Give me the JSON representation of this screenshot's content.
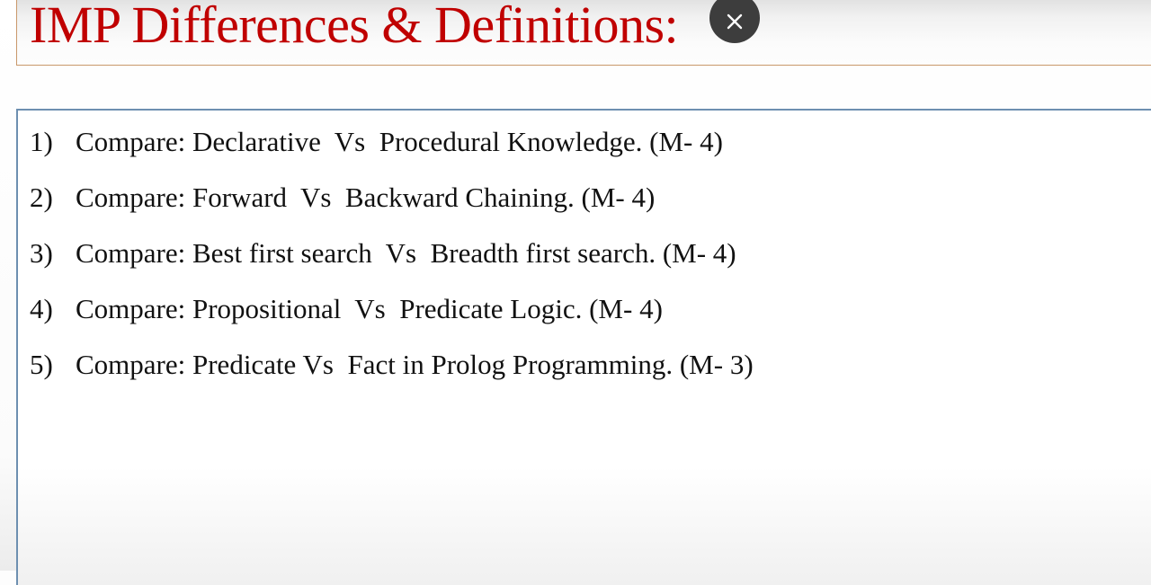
{
  "title": "IMP Differences & Definitions:",
  "close_icon": "close-icon",
  "questions": [
    {
      "num": "1)",
      "text": "Compare: Declarative  Vs  Procedural Knowledge. (M- 4)"
    },
    {
      "num": "2)",
      "text": "Compare: Forward  Vs  Backward Chaining. (M- 4)"
    },
    {
      "num": "3)",
      "text": "Compare: Best first search  Vs  Breadth first search. (M- 4)"
    },
    {
      "num": "4)",
      "text": "Compare: Propositional  Vs  Predicate Logic. (M- 4)"
    },
    {
      "num": "5)",
      "text": "Compare: Predicate Vs  Fact in Prolog Programming. (M- 3)"
    }
  ]
}
